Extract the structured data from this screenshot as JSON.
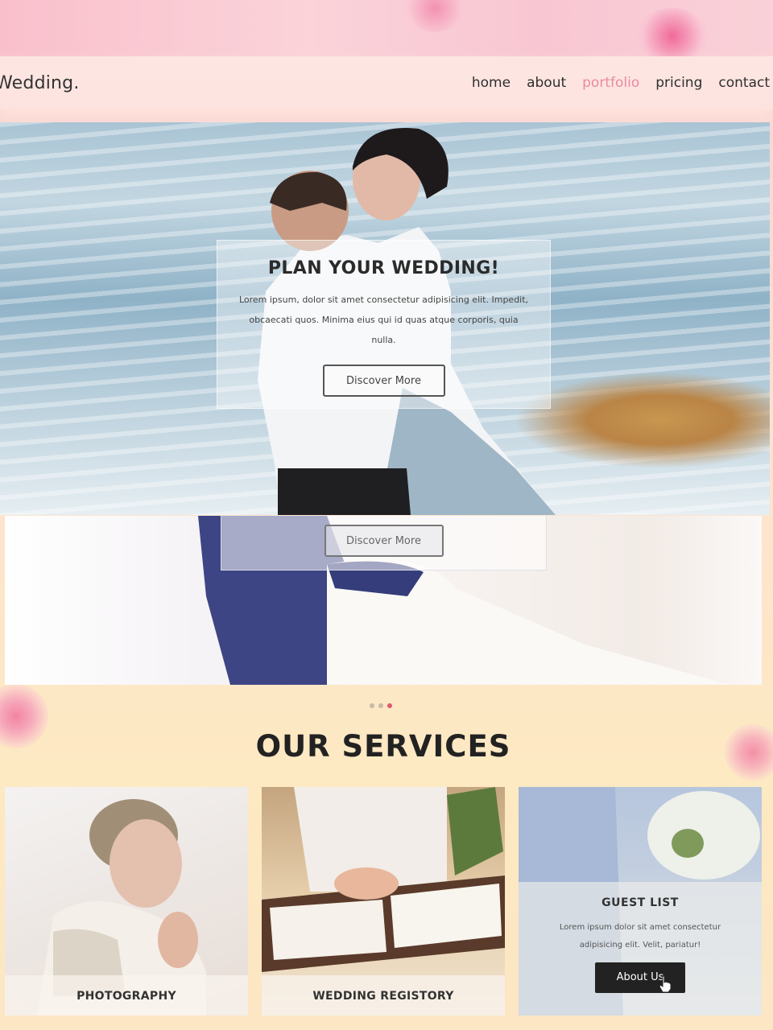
{
  "nav": {
    "logo": "Wedding.",
    "links": [
      {
        "label": "home"
      },
      {
        "label": "about"
      },
      {
        "label": "portfolio",
        "active": true
      },
      {
        "label": "pricing"
      },
      {
        "label": "contact"
      }
    ]
  },
  "hero": {
    "title": "PLAN YOUR WEDDING!",
    "text": "Lorem ipsum, dolor sit amet consectetur adipisicing elit. Impedit, obcaecati quos. Minima eius qui id quas atque corporis, quia nulla.",
    "button": "Discover More"
  },
  "slide2": {
    "button": "Discover More"
  },
  "carousel": {
    "slide_count": 3,
    "active_index": 2
  },
  "services": {
    "title": "OUR SERVICES",
    "items": [
      {
        "label": "PHOTOGRAPHY"
      },
      {
        "label": "WEDDING REGISTORY"
      },
      {
        "label": "GUEST LIST",
        "text": "Lorem ipsum dolor sit amet consectetur adipisicing elit. Velit, pariatur!",
        "button": "About Us"
      }
    ]
  },
  "colors": {
    "accent": "#e98aa2",
    "dot_active": "#e0586f",
    "button_dark": "#222222"
  },
  "icons": {
    "cursor": "pointer-hand-icon"
  }
}
